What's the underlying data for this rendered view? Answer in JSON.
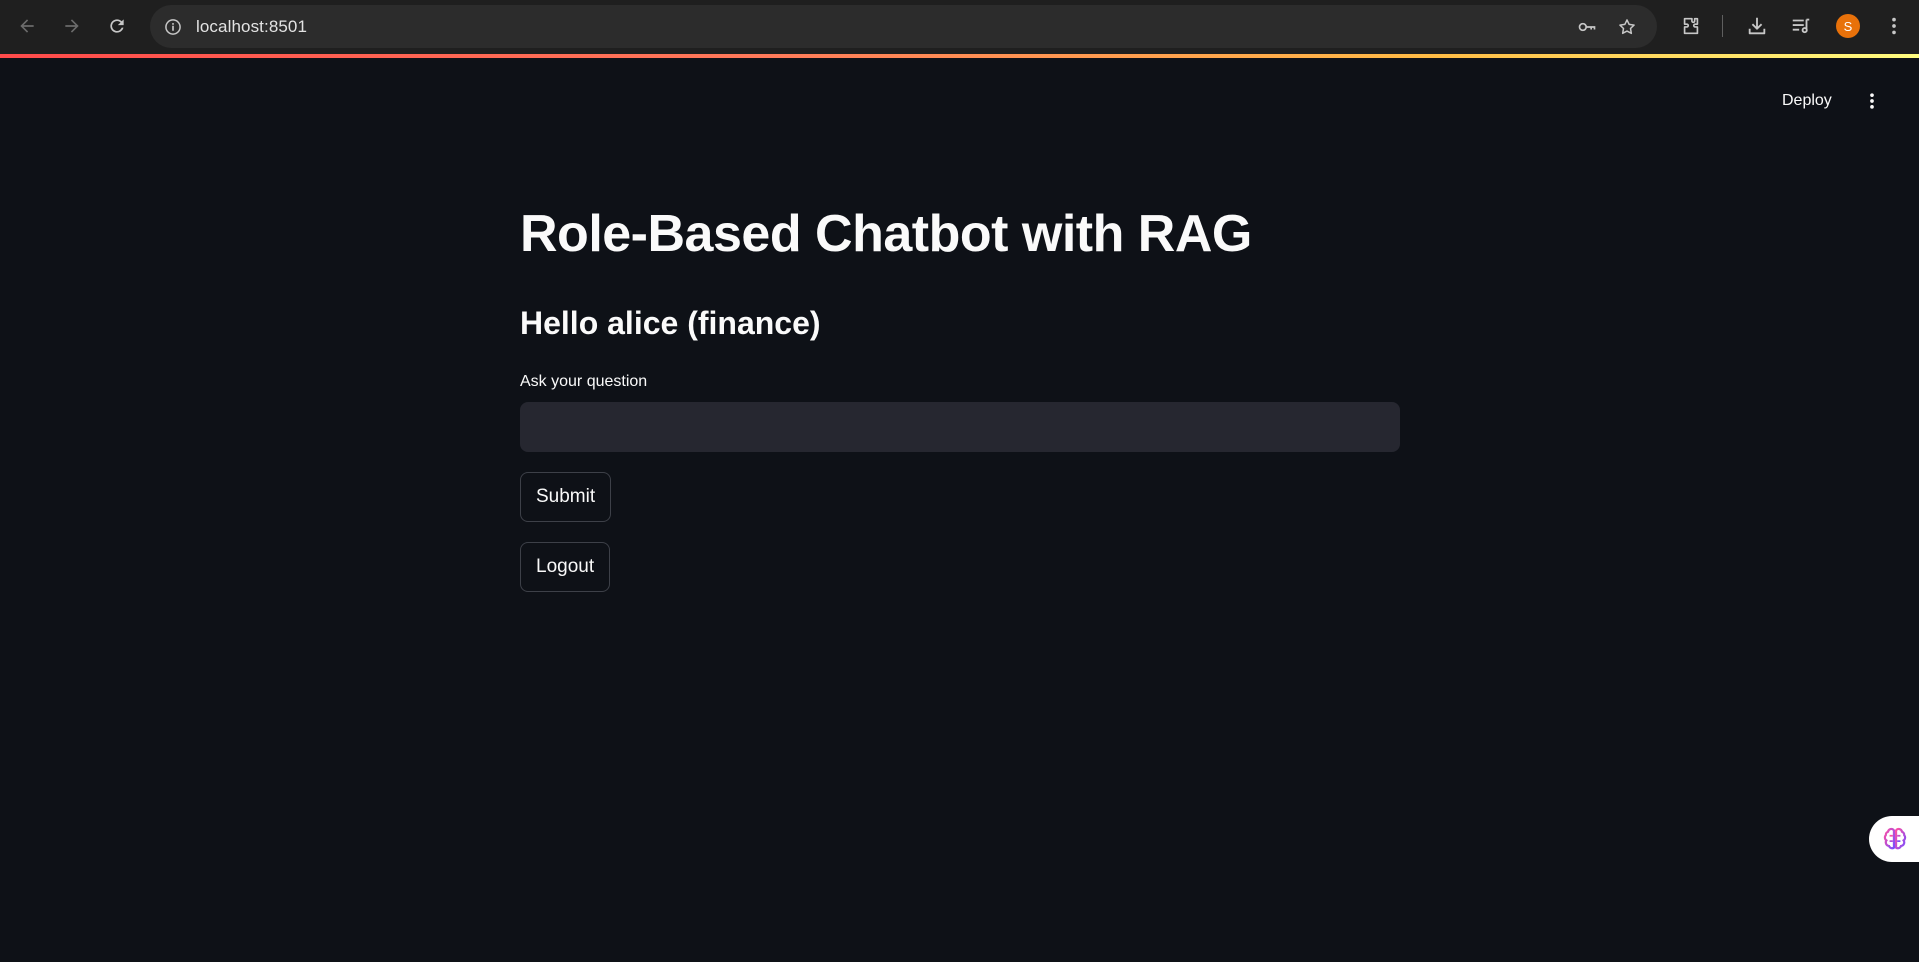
{
  "browser": {
    "url": "localhost:8501",
    "avatar_letter": "S",
    "avatar_color": "#e8710a",
    "icons": [
      "back-icon",
      "forward-icon",
      "reload-icon",
      "site-info-icon",
      "key-icon",
      "star-icon",
      "extensions-icon",
      "download-icon",
      "reading-list-icon",
      "menu-icon"
    ]
  },
  "header": {
    "deploy_label": "Deploy"
  },
  "main": {
    "title": "Role-Based Chatbot with RAG",
    "greeting": "Hello alice (finance)",
    "question_label": "Ask your question",
    "question_value": "",
    "submit_label": "Submit",
    "logout_label": "Logout"
  },
  "colors": {
    "background": "#0e1117",
    "input_bg": "#262730",
    "text": "#fafafa",
    "button_border": "#3d4048"
  }
}
